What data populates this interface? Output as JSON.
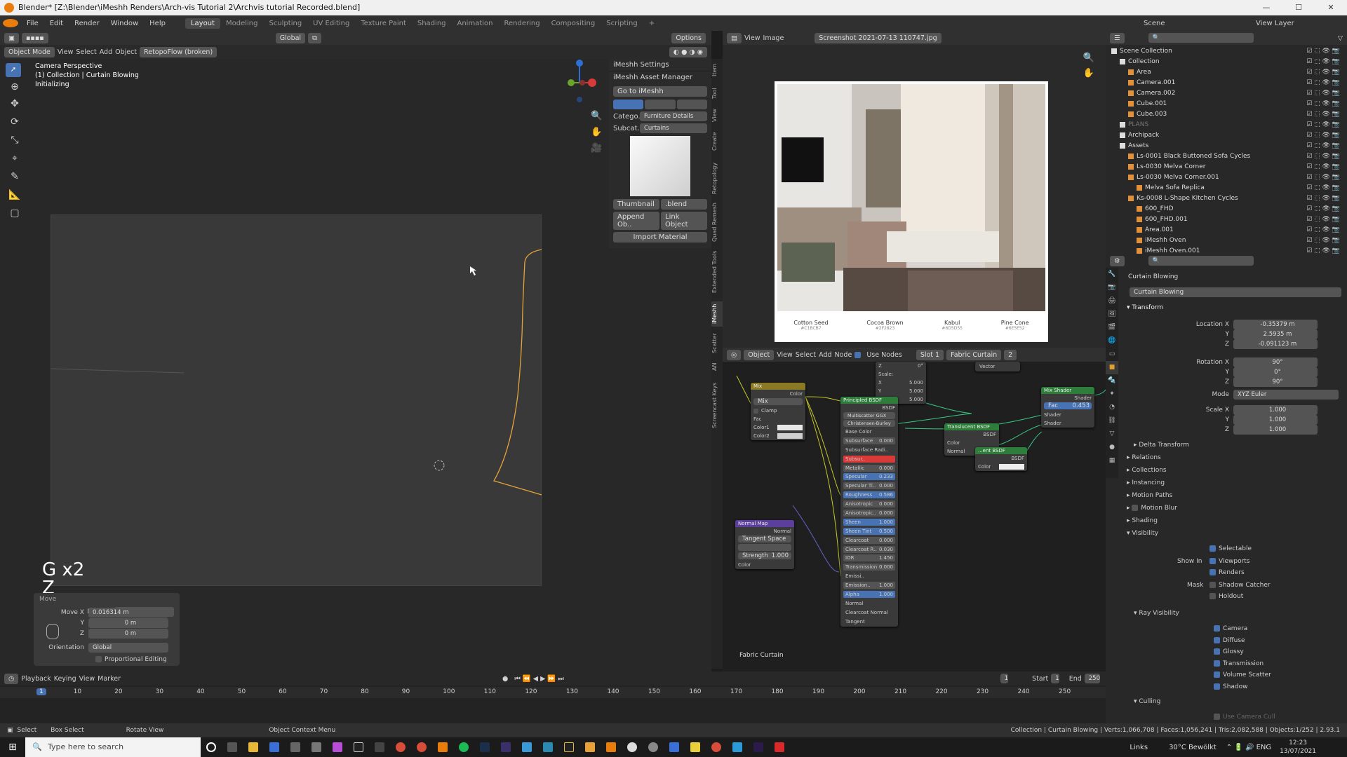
{
  "window": {
    "title": "Blender* [Z:\\Blender\\iMeshh Renders\\Arch-vis Tutorial 2\\Archvis tutorial Recorded.blend]",
    "controls": [
      "—",
      "☐",
      "✕"
    ]
  },
  "menu": {
    "items": [
      "File",
      "Edit",
      "Render",
      "Window",
      "Help"
    ],
    "workspaces": [
      "Layout",
      "Modeling",
      "Sculpting",
      "UV Editing",
      "Texture Paint",
      "Shading",
      "Animation",
      "Rendering",
      "Compositing",
      "Scripting"
    ],
    "active_workspace": "Layout",
    "scene_label": "Scene",
    "view_layer_label": "View Layer"
  },
  "viewport": {
    "mode": "Object Mode",
    "menus": [
      "View",
      "Select",
      "Add",
      "Object"
    ],
    "addon_menu": "RetopoFlow (broken)",
    "orientation": "Global",
    "options": "Options",
    "overlay_lines": [
      "Camera Perspective",
      "(1) Collection | Curtain Blowing",
      "Initializing"
    ],
    "key_hint_1": "G x2",
    "key_hint_2": "Z"
  },
  "move_panel": {
    "title": "Move",
    "labels": [
      "Move X",
      "Y",
      "Z"
    ],
    "values": [
      "0.016314 m",
      "0 m",
      "0 m"
    ],
    "orientation_label": "Orientation",
    "orientation_value": "Global",
    "proportional": "Proportional Editing"
  },
  "imeshh": {
    "settings": "iMeshh Settings",
    "asset_manager": "iMeshh Asset Manager",
    "go_button": "Go to iMeshh",
    "category_label": "Catego..",
    "category_value": "Furniture Details",
    "subcat_label": "Subcat..",
    "subcat_value": "Curtains",
    "thumbnail_btn": "Thumbnail",
    "blend_btn": ".blend",
    "append_btn": "Append Ob..",
    "link_btn": "Link Object",
    "import_material": "Import Material"
  },
  "vertical_tabs": [
    "Item",
    "Tool",
    "View",
    "Create",
    "Retopology",
    "Quad Remesh",
    "Extended Tools",
    "iMeshh",
    "Scatter",
    "AN",
    "Screencast Keys"
  ],
  "image_editor": {
    "menus": [
      "View",
      "Image"
    ],
    "image_name": "Screenshot 2021-07-13 110747.jpg",
    "swatches": [
      {
        "name": "Cotton Seed",
        "code": "#C1BCB7",
        "color": "#5d6352"
      },
      {
        "name": "Cocoa Brown",
        "code": "#2F2823",
        "color": "#a0877a"
      },
      {
        "name": "Kabul",
        "code": "#6D5D55",
        "color": "#6d5d55"
      },
      {
        "name": "Pine Cone",
        "code": "#6E5E52",
        "color": "#7a6558"
      }
    ]
  },
  "node_editor": {
    "type": "Object",
    "menus": [
      "View",
      "Select",
      "Add",
      "Node"
    ],
    "use_nodes": "Use Nodes",
    "slot": "Slot 1",
    "material": "Fabric Curtain",
    "users": "2",
    "frame_label": "Fabric Curtain",
    "mix_node": {
      "title": "Mix",
      "out": "Color",
      "mode": "Mix",
      "clamp": "Clamp",
      "rows": [
        "Fac",
        "Color1",
        "Color2"
      ]
    },
    "normal_map": {
      "title": "Normal Map",
      "out": "Normal",
      "space": "Tangent Space",
      "strength_label": "Strength",
      "strength": "1.000",
      "in": "Color"
    },
    "mapping": {
      "rows": [
        {
          "l": "Z",
          "v": "0°"
        },
        {
          "l": "Scale:",
          "v": ""
        },
        {
          "l": "X",
          "v": "5.000"
        },
        {
          "l": "Y",
          "v": "5.000"
        },
        {
          "l": "Z",
          "v": "5.000"
        }
      ],
      "vector": "Vector"
    },
    "principled": {
      "title": "Principled BSDF",
      "out": "BSDF",
      "dist": "Multiscatter GGX",
      "sss": "Christensen-Burley",
      "rows": [
        {
          "l": "Base Color",
          "v": ""
        },
        {
          "l": "Subsurface",
          "v": "0.000"
        },
        {
          "l": "Subsurface Radi..",
          "v": ""
        },
        {
          "l": "Subsur..",
          "v": ""
        },
        {
          "l": "Metallic",
          "v": "0.000"
        },
        {
          "l": "Specular",
          "v": "0.233"
        },
        {
          "l": "Specular Ti..",
          "v": "0.000"
        },
        {
          "l": "Roughness",
          "v": "0.586"
        },
        {
          "l": "Anisotropic",
          "v": "0.000"
        },
        {
          "l": "Anisotropic..",
          "v": "0.000"
        },
        {
          "l": "Sheen",
          "v": "1.000"
        },
        {
          "l": "Sheen Tint",
          "v": "0.500"
        },
        {
          "l": "Clearcoat",
          "v": "0.000"
        },
        {
          "l": "Clearcoat R..",
          "v": "0.030"
        },
        {
          "l": "IOR",
          "v": "1.450"
        },
        {
          "l": "Transmission",
          "v": "0.000"
        },
        {
          "l": "Emissi..",
          "v": ""
        },
        {
          "l": "Emission..",
          "v": "1.000"
        },
        {
          "l": "Alpha",
          "v": "1.000"
        },
        {
          "l": "Normal",
          "v": ""
        },
        {
          "l": "Clearcoat Normal",
          "v": ""
        },
        {
          "l": "Tangent",
          "v": ""
        }
      ]
    },
    "translucent": {
      "title": "Translucent BSDF",
      "out": "BSDF",
      "rows": [
        "Color",
        "Normal"
      ]
    },
    "diffuse": {
      "title": "...ent BSDF",
      "out": "BSDF",
      "rows": [
        "Color"
      ]
    },
    "mix_shader": {
      "title": "Mix Shader",
      "out": "Shader",
      "fac": "Fac",
      "fac_v": "0.453",
      "rows": [
        "Shader",
        "Shader"
      ]
    }
  },
  "outliner": {
    "rows": [
      {
        "d": 0,
        "t": "Scene Collection",
        "c": "#ddd"
      },
      {
        "d": 1,
        "t": "Collection",
        "c": "#ddd"
      },
      {
        "d": 2,
        "t": "Area",
        "c": "#ddd"
      },
      {
        "d": 2,
        "t": "Camera.001",
        "c": "#ddd"
      },
      {
        "d": 2,
        "t": "Camera.002",
        "c": "#ddd"
      },
      {
        "d": 2,
        "t": "Cube.001",
        "c": "#ddd"
      },
      {
        "d": 2,
        "t": "Cube.003",
        "c": "#ddd"
      },
      {
        "d": 1,
        "t": "PLANS",
        "c": "#777"
      },
      {
        "d": 1,
        "t": "Archipack",
        "c": "#ddd"
      },
      {
        "d": 1,
        "t": "Assets",
        "c": "#ddd"
      },
      {
        "d": 2,
        "t": "Ls-0001 Black Buttoned Sofa Cycles",
        "c": "#ddd"
      },
      {
        "d": 2,
        "t": "Ls-0030 Melva Corner",
        "c": "#ddd"
      },
      {
        "d": 2,
        "t": "Ls-0030 Melva Corner.001",
        "c": "#ddd"
      },
      {
        "d": 3,
        "t": "Melva Sofa Replica",
        "c": "#ddd"
      },
      {
        "d": 2,
        "t": "Ks-0008 L-Shape Kitchen Cycles",
        "c": "#ddd"
      },
      {
        "d": 3,
        "t": "600_FHD",
        "c": "#ddd"
      },
      {
        "d": 3,
        "t": "600_FHD.001",
        "c": "#ddd"
      },
      {
        "d": 3,
        "t": "Area.001",
        "c": "#ddd"
      },
      {
        "d": 3,
        "t": "iMeshh Oven",
        "c": "#ddd"
      },
      {
        "d": 3,
        "t": "iMeshh Oven.001",
        "c": "#ddd"
      }
    ]
  },
  "properties": {
    "object_name": "Curtain Blowing",
    "datablock": "Curtain Blowing",
    "transform": "Transform",
    "location_label": "Location X",
    "loc": [
      "-0.35379 m",
      "2.5935 m",
      "-0.091123 m"
    ],
    "rotation_label": "Rotation X",
    "rot": [
      "90°",
      "0°",
      "90°"
    ],
    "mode_label": "Mode",
    "mode": "XYZ Euler",
    "scale_label": "Scale X",
    "scale": [
      "1.000",
      "1.000",
      "1.000"
    ],
    "axis": [
      "Y",
      "Z"
    ],
    "sections": [
      "Delta Transform",
      "Relations",
      "Collections",
      "Instancing",
      "Motion Paths",
      "Motion Blur",
      "Shading",
      "Visibility"
    ],
    "selectable": "Selectable",
    "show_in": "Show In",
    "viewports": "Viewports",
    "renders": "Renders",
    "mask": "Mask",
    "shadow_catcher": "Shadow Catcher",
    "holdout": "Holdout",
    "ray_visibility": "Ray Visibility",
    "rays": [
      "Camera",
      "Diffuse",
      "Glossy",
      "Transmission",
      "Volume Scatter",
      "Shadow"
    ],
    "culling": "Culling",
    "use_camera_cull": "Use Camera Cull"
  },
  "timeline": {
    "menus": [
      "Playback",
      "Keying",
      "View",
      "Marker"
    ],
    "current": "1",
    "start_label": "Start",
    "start": "1",
    "end_label": "End",
    "end": "250",
    "ticks": [
      "1",
      "10",
      "20",
      "30",
      "40",
      "50",
      "60",
      "70",
      "80",
      "90",
      "100",
      "110",
      "120",
      "130",
      "140",
      "150",
      "160",
      "170",
      "180",
      "190",
      "200",
      "210",
      "220",
      "230",
      "240",
      "250"
    ]
  },
  "status": {
    "select": "Select",
    "box_select": "Box Select",
    "rotate": "Rotate View",
    "context": "Object Context Menu",
    "stats": "Collection | Curtain Blowing | Verts:1,066,708 | Faces:1,056,241 | Tris:2,082,588 | Objects:1/252 | 2.93.1"
  },
  "taskbar": {
    "search": "Type here to search",
    "links": "Links",
    "weather": "30°C Bewölkt",
    "time": "12:23",
    "date": "13/07/2021"
  }
}
